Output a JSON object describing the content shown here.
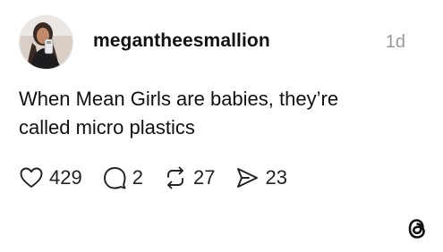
{
  "post": {
    "username": "megantheesmallion",
    "timestamp": "1d",
    "text_lines": [
      "When Mean Girls are babies, they’re",
      "called micro plastics"
    ]
  },
  "actions": {
    "like_count": "429",
    "reply_count": "2",
    "repost_count": "27",
    "share_count": "23"
  },
  "icons": {
    "like": "heart-icon",
    "reply": "speech-bubble-icon",
    "repost": "repost-arrows-icon",
    "share": "send-icon",
    "brand": "threads-logo-icon"
  },
  "colors": {
    "text": "#111111",
    "muted": "#9a9a9a",
    "background": "#ffffff"
  }
}
